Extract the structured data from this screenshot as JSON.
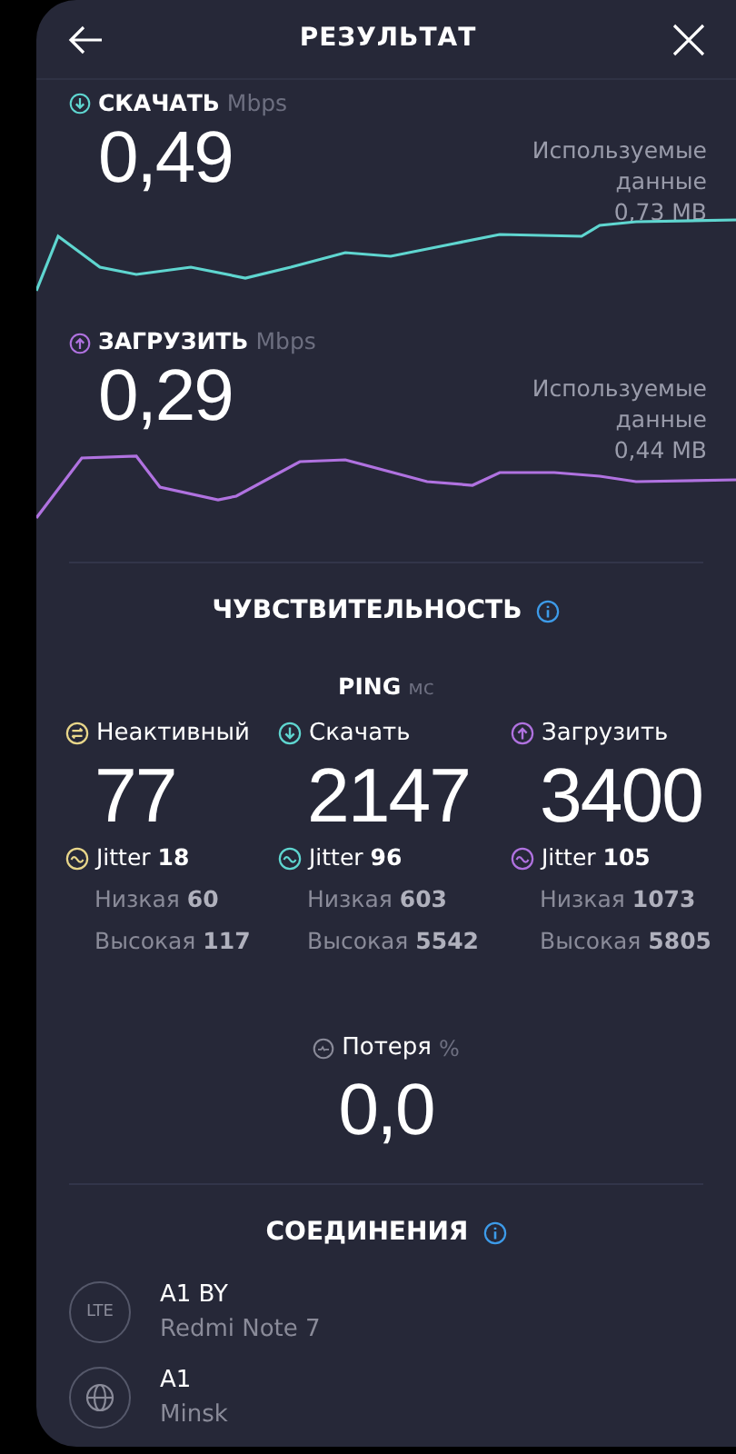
{
  "header": {
    "title": "РЕЗУЛЬТАТ"
  },
  "speeds": [
    {
      "kind": "download",
      "label": "СКАЧАТЬ",
      "unit": "Mbps",
      "value": "0,49",
      "data_label": "Используемые данные",
      "data_value": "0,73 MB",
      "color": "#5fd6d0"
    },
    {
      "kind": "upload",
      "label": "ЗАГРУЗИТЬ",
      "unit": "Mbps",
      "value": "0,29",
      "data_label": "Используемые данные",
      "data_value": "0,44 MB",
      "color": "#b072e0"
    }
  ],
  "sensitivity": {
    "title": "ЧУВСТВИТЕЛЬНОСТЬ",
    "ping_label": "PING",
    "ping_unit": "мс",
    "items": [
      {
        "kind": "idle",
        "label": "Неактивный",
        "value": "77",
        "jitter": "Jitter **18**",
        "low": "Низкая **60**",
        "high": "Высокая **117**",
        "color": "#e8d68a"
      },
      {
        "kind": "download",
        "label": "Скачать",
        "value": "2147",
        "jitter": "Jitter **96**",
        "low": "Низкая **603**",
        "high": "Высокая **5542**",
        "color": "#5fd6d0"
      },
      {
        "kind": "upload",
        "label": "Загрузить",
        "value": "3400",
        "jitter": "Jitter **105**",
        "low": "Низкая **1073**",
        "high": "Высокая **5805**",
        "color": "#b072e0"
      }
    ]
  },
  "loss": {
    "label": "Потеря",
    "unit": "%",
    "value": "0,0"
  },
  "connections": {
    "title": "СОЕДИНЕНИЯ",
    "items": [
      {
        "kind": "lte",
        "badge": "LTE",
        "name": "A1 BY",
        "detail": "Redmi Note 7"
      },
      {
        "kind": "server",
        "name": "A1",
        "detail": "Minsk"
      }
    ]
  }
}
